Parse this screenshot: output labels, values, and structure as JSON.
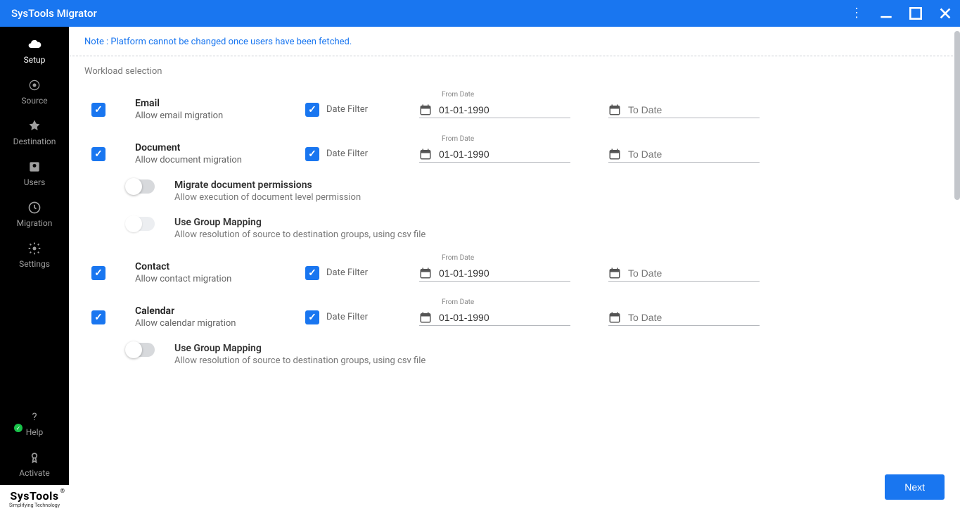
{
  "titlebar": {
    "title": "SysTools Migrator"
  },
  "sidebar": {
    "items": [
      {
        "label": "Setup"
      },
      {
        "label": "Source"
      },
      {
        "label": "Destination"
      },
      {
        "label": "Users"
      },
      {
        "label": "Migration"
      },
      {
        "label": "Settings"
      }
    ],
    "bottom": [
      {
        "label": "Help"
      },
      {
        "label": "Activate"
      }
    ],
    "brand": {
      "name": "SysTools",
      "tag": "Simplifying Technology",
      "reg": "®"
    }
  },
  "main": {
    "note": "Note : Platform cannot be changed once users have been fetched.",
    "section_label": "Workload selection",
    "date_filter_label": "Date Filter",
    "from_date_label": "From Date",
    "to_date_placeholder": "To Date",
    "workloads": [
      {
        "key": "email",
        "title": "Email",
        "subtitle": "Allow email migration",
        "from_date": "01-01-1990"
      },
      {
        "key": "document",
        "title": "Document",
        "subtitle": "Allow document migration",
        "from_date": "01-01-1990",
        "sub_options": [
          {
            "title": "Migrate document permissions",
            "desc": "Allow execution of document level permission",
            "enabled": true
          },
          {
            "title": "Use Group Mapping",
            "desc": "Allow resolution of source to destination groups, using csv file",
            "enabled": false
          }
        ]
      },
      {
        "key": "contact",
        "title": "Contact",
        "subtitle": "Allow contact migration",
        "from_date": "01-01-1990"
      },
      {
        "key": "calendar",
        "title": "Calendar",
        "subtitle": "Allow calendar migration",
        "from_date": "01-01-1990",
        "sub_options": [
          {
            "title": "Use Group Mapping",
            "desc": "Allow resolution of source to destination groups, using csv file",
            "enabled": true
          }
        ]
      }
    ],
    "next_label": "Next"
  }
}
